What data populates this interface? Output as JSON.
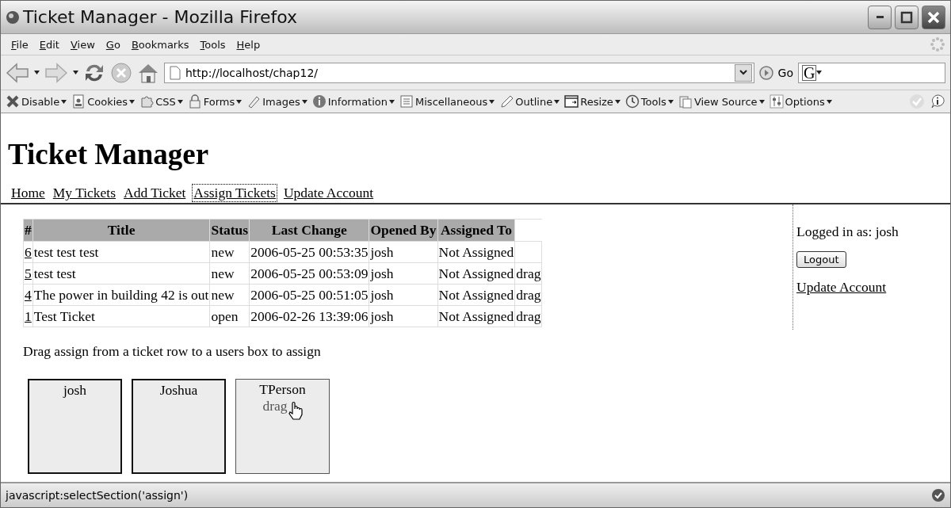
{
  "window": {
    "title": "Ticket Manager - Mozilla Firefox"
  },
  "menu": [
    "File",
    "Edit",
    "View",
    "Go",
    "Bookmarks",
    "Tools",
    "Help"
  ],
  "address_bar": {
    "value": "http://localhost/chap12/",
    "go_label": "Go",
    "search_engine": "G"
  },
  "dev_toolbar": [
    {
      "label": "Disable",
      "kind": "x"
    },
    {
      "label": "Cookies",
      "kind": "card"
    },
    {
      "label": "CSS",
      "kind": "puzzle"
    },
    {
      "label": "Forms",
      "kind": "lock"
    },
    {
      "label": "Images",
      "kind": "brush"
    },
    {
      "label": "Information",
      "kind": "info"
    },
    {
      "label": "Miscellaneous",
      "kind": "list"
    },
    {
      "label": "Outline",
      "kind": "pencil"
    },
    {
      "label": "Resize",
      "kind": "window"
    },
    {
      "label": "Tools",
      "kind": "clock"
    },
    {
      "label": "View Source",
      "kind": "clipboard"
    },
    {
      "label": "Options",
      "kind": "sliders"
    }
  ],
  "page": {
    "heading": "Ticket Manager",
    "nav": [
      {
        "label": "Home",
        "focused": false
      },
      {
        "label": "My Tickets",
        "focused": false
      },
      {
        "label": "Add Ticket",
        "focused": false
      },
      {
        "label": "Assign Tickets",
        "focused": true
      },
      {
        "label": "Update Account",
        "focused": false
      }
    ],
    "table": {
      "columns": [
        "#",
        "Title",
        "Status",
        "Last Change",
        "Opened By",
        "Assigned To"
      ],
      "rows": [
        {
          "id": "6",
          "title": "test test test",
          "status": "new",
          "last_change": "2006-05-25 00:53:35",
          "opened_by": "josh",
          "assigned_to": "Not Assigned"
        },
        {
          "id": "5",
          "title": "test test",
          "status": "new",
          "last_change": "2006-05-25 00:53:09",
          "opened_by": "josh",
          "assigned_to": "Not Assigned",
          "handle": "drag"
        },
        {
          "id": "4",
          "title": "The power in building 42 is out",
          "status": "new",
          "last_change": "2006-05-25 00:51:05",
          "opened_by": "josh",
          "assigned_to": "Not Assigned",
          "handle": "drag"
        },
        {
          "id": "1",
          "title": "Test Ticket",
          "status": "open",
          "last_change": "2006-02-26 13:39:06",
          "opened_by": "josh",
          "assigned_to": "Not Assigned",
          "handle": "drag"
        }
      ]
    },
    "instructions": "Drag assign from a ticket row to a users box to assign",
    "user_boxes": [
      {
        "name": "josh",
        "highlighted": false
      },
      {
        "name": "Joshua",
        "highlighted": false
      },
      {
        "name": "TPerson",
        "highlighted": true,
        "dragged_text": "drag"
      }
    ],
    "sidebar": {
      "logged_in": "Logged in as: josh",
      "logout": "Logout",
      "link": "Update Account"
    }
  },
  "status_bar": {
    "text": "javascript:selectSection('assign')"
  }
}
